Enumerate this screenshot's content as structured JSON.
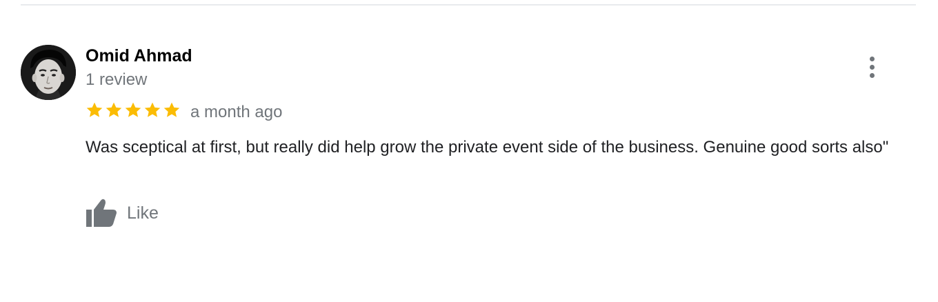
{
  "review": {
    "author_name": "Omid Ahmad",
    "review_count": "1 review",
    "rating": 5,
    "rating_max": 5,
    "time": "a month ago",
    "text": "Was sceptical at first, but really did help grow the private event side of the business. Genuine good sorts also\"",
    "like_label": "Like"
  },
  "icons": {
    "avatar": "profile-photo",
    "star": "star-icon",
    "more": "more-vert-icon",
    "like": "thumbs-up-icon"
  },
  "colors": {
    "star": "#fbbc04",
    "secondary_text": "#70757a",
    "divider": "#e8eaed"
  }
}
